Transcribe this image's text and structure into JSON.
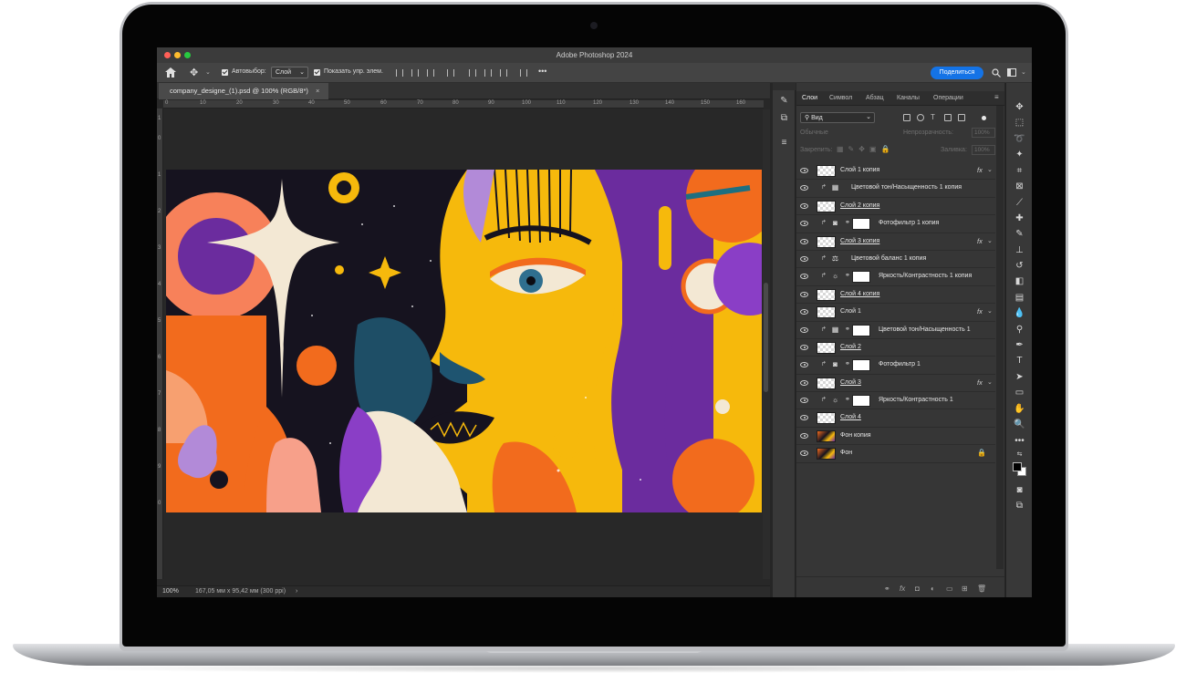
{
  "window": {
    "title": "Adobe Photoshop 2024"
  },
  "options_bar": {
    "auto_select_label": "Автовыбор:",
    "auto_select_value": "Слой",
    "show_transform_label": "Показать упр. элем.",
    "more": "•••",
    "share_button": "Поделиться"
  },
  "document": {
    "tab_title": "company_designe_(1).psd @ 100% (RGB/8*)",
    "zoom": "100%",
    "doc_info": "167,05 мм x 95,42 мм (300 ppi)",
    "status_arrow": "›"
  },
  "rulers": {
    "horizontal": [
      "0",
      "10",
      "20",
      "30",
      "40",
      "50",
      "60",
      "70",
      "80",
      "90",
      "100",
      "110",
      "120",
      "130",
      "140",
      "150",
      "160"
    ],
    "vertical": [
      "1",
      "0",
      "1",
      "2",
      "3",
      "4",
      "5",
      "6",
      "7",
      "8",
      "9",
      "0"
    ]
  },
  "layers_panel": {
    "tabs": [
      "Слои",
      "Символ",
      "Абзац",
      "Каналы",
      "Операции"
    ],
    "filter_kind": "Вид",
    "blend_mode": "Обычные",
    "opacity_label": "Непрозрачность:",
    "opacity_value": "100%",
    "lock_label": "Закрепить:",
    "fill_label": "Заливка:",
    "fill_value": "100%",
    "layers": [
      {
        "name": "Слой 1 копия",
        "kind": "pixel",
        "fx": "fx",
        "underline": false
      },
      {
        "name": "Цветовой тон/Насыщенность 1 копия",
        "kind": "adj",
        "icon": "▦",
        "mask": false,
        "underline": false
      },
      {
        "name": "Слой 2 копия",
        "kind": "pixel",
        "underline": true
      },
      {
        "name": "Фотофильтр 1 копия",
        "kind": "adj",
        "icon": "◙",
        "mask": true,
        "underline": false
      },
      {
        "name": "Слой 3 копия",
        "kind": "pixel",
        "fx": "fx",
        "underline": true
      },
      {
        "name": "Цветовой баланс 1 копия",
        "kind": "adj",
        "icon": "⚖",
        "mask": false,
        "underline": false
      },
      {
        "name": "Яркость/Контрастность 1 копия",
        "kind": "adj",
        "icon": "☼",
        "mask": true,
        "underline": false
      },
      {
        "name": "Слой 4 копия",
        "kind": "pixel",
        "underline": true
      },
      {
        "name": "Слой 1",
        "kind": "pixel",
        "fx": "fx",
        "underline": false
      },
      {
        "name": "Цветовой тон/Насыщенность 1",
        "kind": "adj",
        "icon": "▦",
        "mask": true,
        "underline": false
      },
      {
        "name": "Слой 2",
        "kind": "pixel",
        "underline": true
      },
      {
        "name": "Фотофильтр 1",
        "kind": "adj",
        "icon": "◙",
        "mask": true,
        "underline": false
      },
      {
        "name": "Слой 3",
        "kind": "pixel",
        "fx": "fx",
        "underline": true
      },
      {
        "name": "Яркость/Контрастность 1",
        "kind": "adj",
        "icon": "☼",
        "mask": true,
        "underline": false
      },
      {
        "name": "Слой 4",
        "kind": "pixel",
        "underline": true
      },
      {
        "name": "Фон копия",
        "kind": "image",
        "underline": false
      },
      {
        "name": "Фон",
        "kind": "image",
        "locked": true,
        "underline": false
      }
    ]
  },
  "colors": {
    "accent_blue": "#1473e6",
    "art_orange": "#f26b1d",
    "art_yellow": "#f6b90c",
    "art_purple": "#6b2c9e",
    "art_navy": "#16131f",
    "art_cream": "#f3e8d4"
  }
}
